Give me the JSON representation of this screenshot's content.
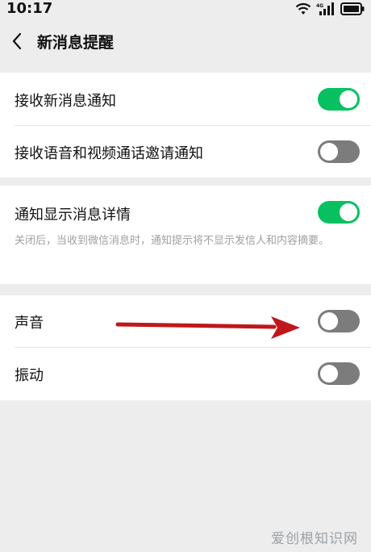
{
  "status_bar": {
    "time": "10:17",
    "icons": [
      "wifi-icon",
      "signal-icon",
      "battery-icon"
    ],
    "network_label": "4G"
  },
  "nav": {
    "back_icon": "chevron-left-icon",
    "title": "新消息提醒"
  },
  "groups": [
    {
      "rows": [
        {
          "label": "接收新消息通知",
          "toggle": true
        },
        {
          "label": "接收语音和视频通话邀请通知",
          "toggle": false
        }
      ]
    },
    {
      "rows": [
        {
          "label": "通知显示消息详情",
          "toggle": true
        }
      ],
      "description": "关闭后，当收到微信消息时，通知提示将不显示发信人和内容摘要。"
    },
    {
      "rows": [
        {
          "label": "声音",
          "toggle": false
        },
        {
          "label": "振动",
          "toggle": false
        }
      ]
    }
  ],
  "annotation": {
    "arrow_color": "#c0171b"
  },
  "colors": {
    "toggle_on": "#07c160",
    "toggle_off": "#7c7c7c",
    "background": "#ededed"
  },
  "watermark": "爱创根知识网"
}
